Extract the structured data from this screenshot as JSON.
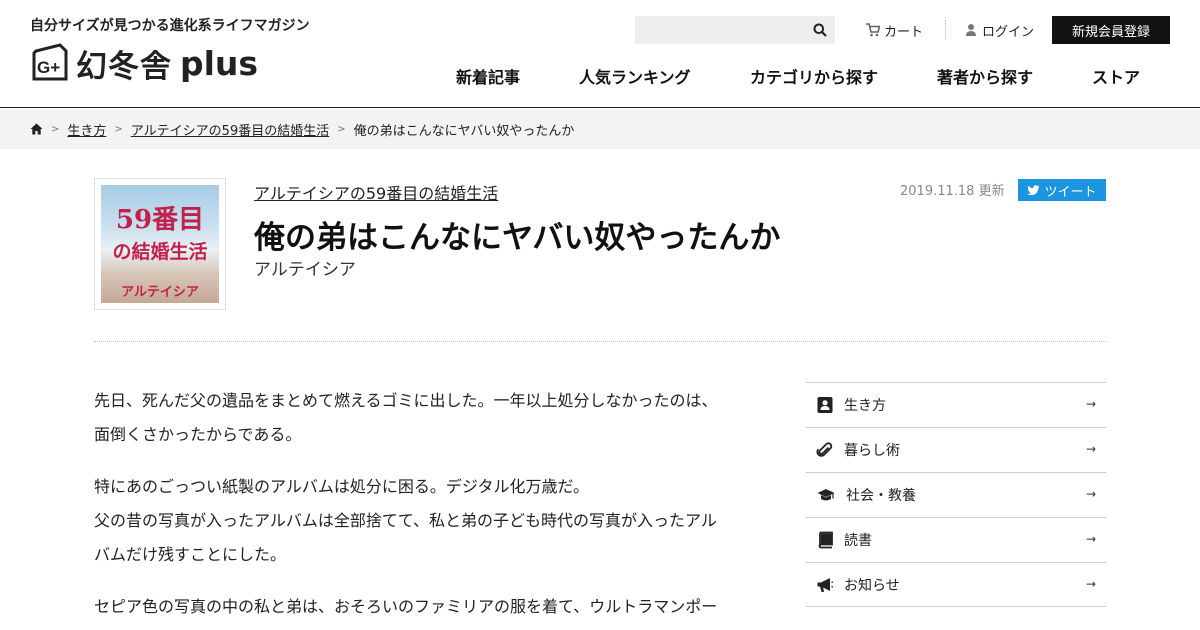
{
  "header": {
    "tagline": "自分サイズが見つかる進化系ライフマガジン",
    "logo_text": "幻冬舎",
    "logo_plus": "plus",
    "search_placeholder": "",
    "cart_label": "カート",
    "login_label": "ログイン",
    "signup_label": "新規会員登録"
  },
  "nav": {
    "items": [
      "新着記事",
      "人気ランキング",
      "カテゴリから探す",
      "著者から探す",
      "ストア"
    ]
  },
  "breadcrumb": {
    "items": [
      "生き方",
      "アルテイシアの59番目の結婚生活",
      "俺の弟はこんなにヤバい奴やったんか"
    ]
  },
  "article": {
    "thumb_line1": "59番目",
    "thumb_line2": "の結婚生活",
    "thumb_line3": "アルテイシア",
    "series": "アルテイシアの59番目の結婚生活",
    "title": "俺の弟はこんなにヤバい奴やったんか",
    "author": "アルテイシア",
    "date": "2019.11.18 更新",
    "tweet_label": "ツイート",
    "paragraphs": [
      [
        "先日、死んだ父の遺品をまとめて燃えるゴミに出した。一年以上処分しなかったのは、",
        "面倒くさかったからである。"
      ],
      [
        "特にあのごっつい紙製のアルバムは処分に困る。デジタル化万歳だ。",
        "父の昔の写真が入ったアルバムは全部捨てて、私と弟の子ども時代の写真が入ったアル",
        "バムだけ残すことにした。"
      ],
      [
        "セピア色の写真の中の私と弟は、おそろいのファミリアの服を着て、ウルトラマンポー"
      ]
    ]
  },
  "sidebar": {
    "items": [
      {
        "label": "生き方",
        "icon": "person-badge-icon"
      },
      {
        "label": "暮らし術",
        "icon": "paperclip-icon"
      },
      {
        "label": "社会・教養",
        "icon": "graduation-cap-icon"
      },
      {
        "label": "読書",
        "icon": "book-icon"
      },
      {
        "label": "お知らせ",
        "icon": "megaphone-icon"
      }
    ],
    "arrow": "→"
  },
  "colors": {
    "accent_tweet": "#1b95e0",
    "signup_bg": "#111111",
    "breadcrumb_bg": "#f3f3f3",
    "thumb_title": "#c2214b"
  }
}
